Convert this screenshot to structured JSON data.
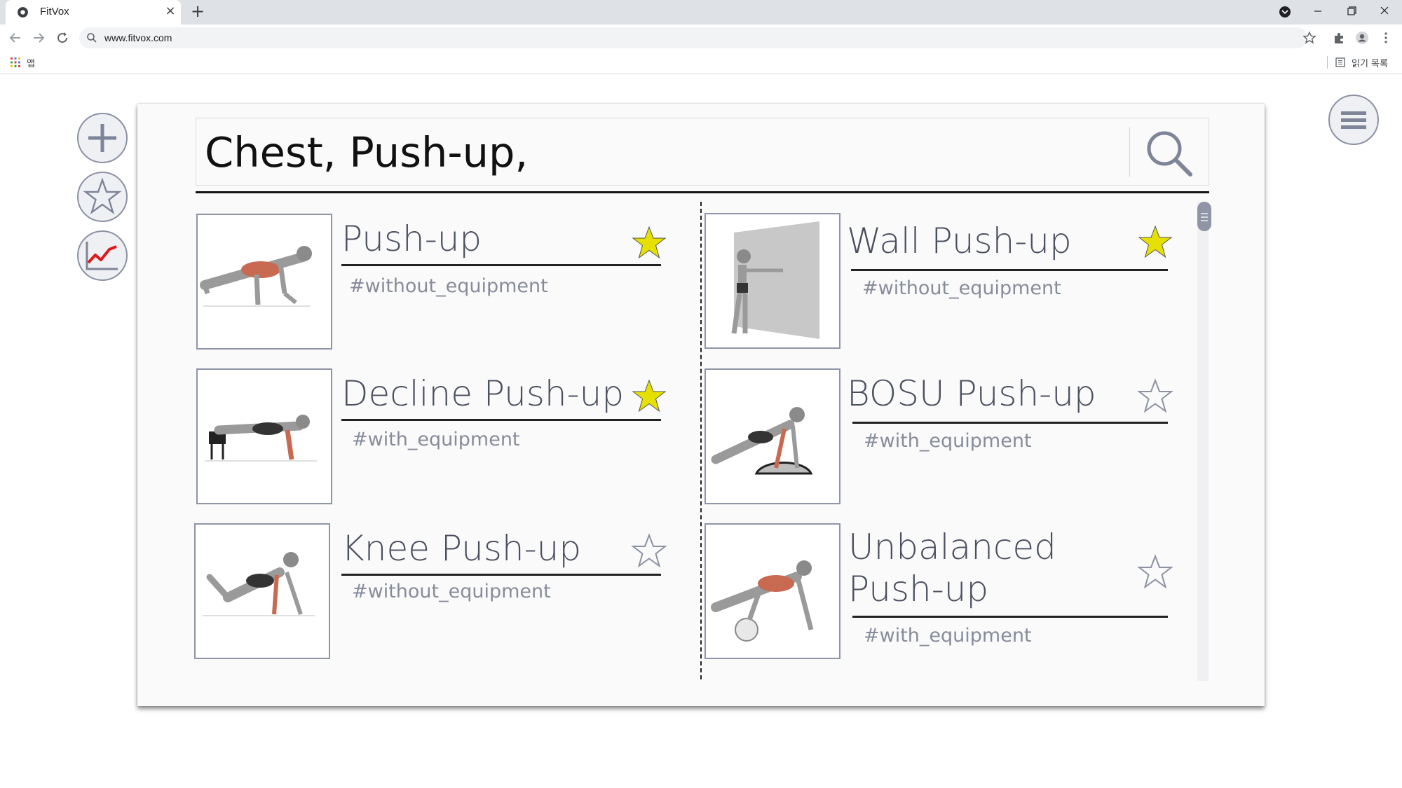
{
  "browser": {
    "tab_title": "FitVox",
    "tab_close": "×",
    "new_tab": "+",
    "url": "www.fitvox.com",
    "bookmark_apps_label": "앱",
    "reading_list_label": "읽기 목록"
  },
  "search": {
    "query": "Chest, Push-up,"
  },
  "exercises": [
    {
      "name": "Push-up",
      "tag": "#without_equipment",
      "favorite": true
    },
    {
      "name": "Decline Push-up",
      "tag": "#with_equipment",
      "favorite": true
    },
    {
      "name": "Knee Push-up",
      "tag": "#without_equipment",
      "favorite": false
    },
    {
      "name": "Wall Push-up",
      "tag": "#without_equipment",
      "favorite": true
    },
    {
      "name": "BOSU Push-up",
      "tag": "#with_equipment",
      "favorite": false
    },
    {
      "name_line1": "Unbalanced",
      "name_line2": "Push-up",
      "tag": "#with_equipment",
      "favorite": false
    }
  ],
  "colors": {
    "favorite_star": "#e6e000",
    "empty_star": "#8c92a4",
    "button_border": "#8c92a4",
    "title_text": "#4b5061",
    "tag_text": "#878c9c"
  },
  "icons": {
    "side_buttons": [
      "plus-icon",
      "star-icon",
      "chart-icon"
    ],
    "menu": "hamburger-icon",
    "search": "search-icon"
  }
}
